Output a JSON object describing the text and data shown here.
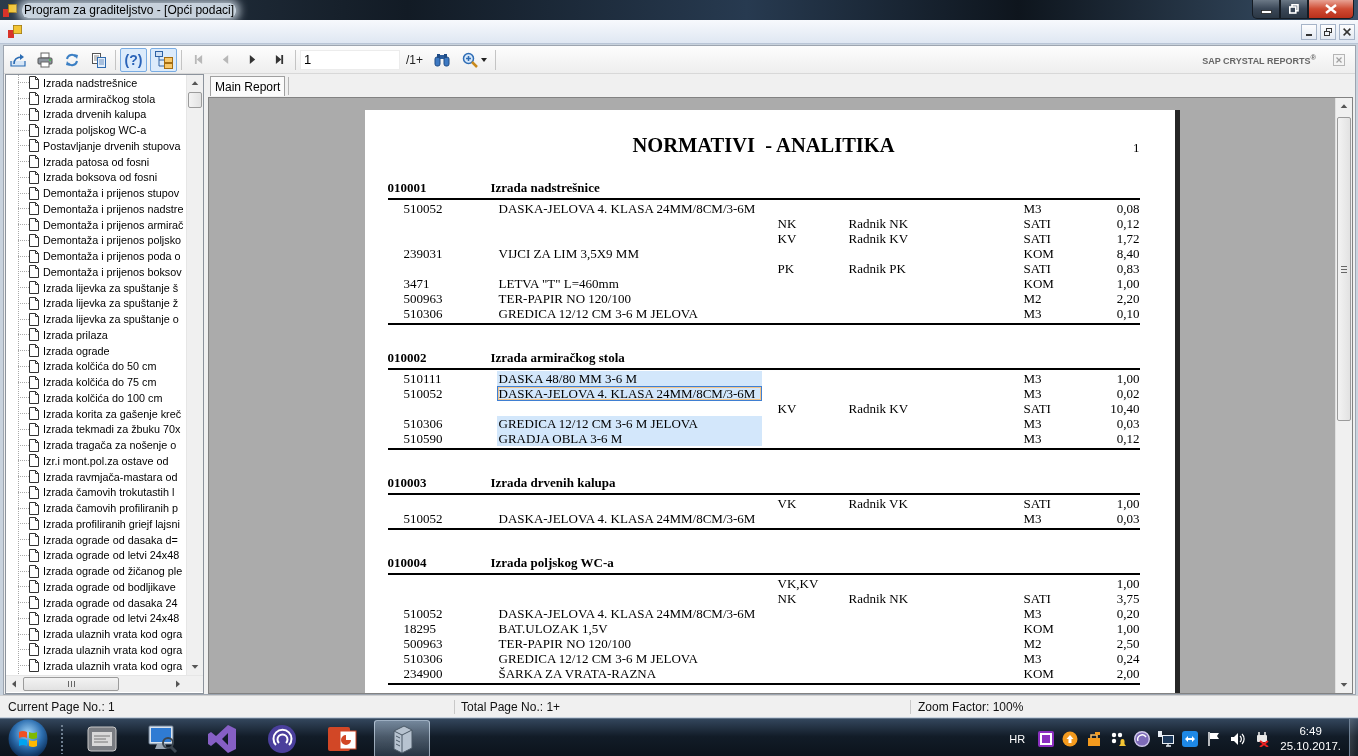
{
  "window": {
    "title": "Program za graditeljstvo - [Opći podaci]"
  },
  "toolbar": {
    "help": {
      "label": "(?)",
      "on": true
    },
    "group_tree": {
      "on": true
    },
    "nav": [
      {
        "kind": "first",
        "disabled": true
      },
      {
        "kind": "previous",
        "disabled": true
      },
      {
        "kind": "next",
        "disabled": false
      },
      {
        "kind": "last",
        "disabled": false
      }
    ],
    "page_field": {
      "value": "1"
    },
    "page_count": "/1+",
    "brand": "SAP CRYSTAL REPORTS$^{®}$"
  },
  "group_tree": {
    "items": [
      {
        "label": "Izrada nadstrešnice",
        "selected": false
      },
      {
        "label": "Izrada armiračkog stola",
        "selected": false
      },
      {
        "label": "Izrada drvenih kalupa",
        "selected": false
      },
      {
        "label": "Izrada poljskog WC-a",
        "selected": false
      },
      {
        "label": "Postavljanje drvenih stupova",
        "selected": false
      },
      {
        "label": "Izrada patosa od fosni",
        "selected": false
      },
      {
        "label": "Izrada boksova od fosni",
        "selected": false
      },
      {
        "label": "Demontaža i prijenos stupov",
        "selected": false
      },
      {
        "label": "Demontaža i prijenos nadstre",
        "selected": false
      },
      {
        "label": "Demontaža i prijenos armirač",
        "selected": false
      },
      {
        "label": "Demontaža i prijenos poljsko",
        "selected": false
      },
      {
        "label": "Demontaža i prijenos poda o",
        "selected": false
      },
      {
        "label": "Demontaža i prijenos boksov",
        "selected": false
      },
      {
        "label": "Izrada lijevka za spuštanje š",
        "selected": false
      },
      {
        "label": "Izrada lijevka za spuštanje ž",
        "selected": false
      },
      {
        "label": "Izrada lijevka za spuštanje o",
        "selected": false
      },
      {
        "label": "Izrada prilaza",
        "selected": false
      },
      {
        "label": "Izrada ograde",
        "selected": false
      },
      {
        "label": "Izrada kolčića do 50 cm",
        "selected": false
      },
      {
        "label": "Izrada kolčića do 75 cm",
        "selected": false
      },
      {
        "label": "Izrada kolčića do 100 cm",
        "selected": false
      },
      {
        "label": "Izrada korita za gašenje kreč",
        "selected": false
      },
      {
        "label": "Izrada tekmadi za žbuku 70x",
        "selected": false
      },
      {
        "label": "Izrada tragača za nošenje o",
        "selected": false
      },
      {
        "label": "Izr.i mont.pol.za ostave od",
        "selected": false
      },
      {
        "label": "Izrada ravmjača-mastara od",
        "selected": false
      },
      {
        "label": "Izrada čamovih trokutastih l",
        "selected": false
      },
      {
        "label": "Izrada čamovih profiliranih p",
        "selected": false
      },
      {
        "label": "Izrada profiliranih griejf lajsni",
        "selected": false
      },
      {
        "label": "Izrada ograde od dasaka d=",
        "selected": false
      },
      {
        "label": "Izrada ograde od letvi 24x48",
        "selected": false
      },
      {
        "label": "Izrada ograde od žičanog ple",
        "selected": false
      },
      {
        "label": "Izrada ograde od bodljikave",
        "selected": false
      },
      {
        "label": "Izrada ograde od dasaka 24",
        "selected": false
      },
      {
        "label": "Izrada ograde od letvi 24x48",
        "selected": false
      },
      {
        "label": "Izrada ulaznih vrata kod ogra",
        "selected": false
      },
      {
        "label": "Izrada ulaznih vrata kod ogra",
        "selected": false
      },
      {
        "label": "Izrada ulaznih vrata kod ogra",
        "selected": false
      }
    ]
  },
  "tabs": [
    {
      "label": "Main Report",
      "selected": true
    }
  ],
  "report": {
    "title": "NORMATIVI  - ANALITIKA",
    "page_number": "1",
    "sections": [
      {
        "heading_1": "010001",
        "heading_2": "Izrada nadstrešnice",
        "rows": [
          {
            "column_1": "510052",
            "column_2": "DASKA-JELOVA 4. KLASA 24MM/8CM/3-6M",
            "column_5": "M3",
            "column_6": "0,08",
            "selected": false,
            "focused": false
          },
          {
            "column_3": "NK",
            "column_4": "Radnik NK",
            "column_5": "SATI",
            "column_6": "0,12",
            "selected": false,
            "focused": false
          },
          {
            "column_3": "KV",
            "column_4": "Radnik KV",
            "column_5": "SATI",
            "column_6": "1,72",
            "selected": false,
            "focused": false
          },
          {
            "column_1": "239031",
            "column_2": "VIJCI ZA LIM 3,5X9 MM",
            "column_5": "KOM",
            "column_6": "8,40",
            "selected": false,
            "focused": false
          },
          {
            "column_3": "PK",
            "column_4": "Radnik PK",
            "column_5": "SATI",
            "column_6": "0,83",
            "selected": false,
            "focused": false
          },
          {
            "column_1": "3471",
            "column_2": "LETVA \"T\" L=460mm",
            "column_5": "KOM",
            "column_6": "1,00",
            "selected": false,
            "focused": false
          },
          {
            "column_1": "500963",
            "column_2": "TER-PAPIR NO 120/100",
            "column_5": "M2",
            "column_6": "2,20",
            "selected": false,
            "focused": false
          },
          {
            "column_1": "510306",
            "column_2": "GREDICA 12/12 CM 3-6 M JELOVA",
            "column_5": "M3",
            "column_6": "0,10",
            "selected": false,
            "focused": false
          }
        ]
      },
      {
        "heading_1": "010002",
        "heading_2": "Izrada armiračkog stola",
        "rows": [
          {
            "column_1": "510111",
            "column_2": "DASKA 48/80 MM 3-6 M",
            "column_5": "M3",
            "column_6": "1,00",
            "selected": true,
            "focused": false
          },
          {
            "column_1": "510052",
            "column_2": "DASKA-JELOVA 4. KLASA 24MM/8CM/3-6M",
            "column_5": "M3",
            "column_6": "0,02",
            "selected": true,
            "focused": true
          },
          {
            "column_3": "KV",
            "column_4": "Radnik KV",
            "column_5": "SATI",
            "column_6": "10,40",
            "selected": false,
            "focused": false
          },
          {
            "column_1": "510306",
            "column_2": "GREDICA 12/12 CM 3-6 M JELOVA",
            "column_5": "M3",
            "column_6": "0,03",
            "selected": true,
            "focused": false
          },
          {
            "column_1": "510590",
            "column_2": "GRADJA OBLA 3-6 M",
            "column_5": "M3",
            "column_6": "0,12",
            "selected": true,
            "focused": false
          }
        ]
      },
      {
        "heading_1": "010003",
        "heading_2": "Izrada drvenih kalupa",
        "rows": [
          {
            "column_3": "VK",
            "column_4": "Radnik VK",
            "column_5": "SATI",
            "column_6": "1,00",
            "selected": false,
            "focused": false
          },
          {
            "column_1": "510052",
            "column_2": "DASKA-JELOVA 4. KLASA 24MM/8CM/3-6M",
            "column_5": "M3",
            "column_6": "0,03",
            "selected": false,
            "focused": false
          }
        ]
      },
      {
        "heading_1": "010004",
        "heading_2": "Izrada poljskog WC-a",
        "rows": [
          {
            "column_3": "VK,KV",
            "column_6": "1,00",
            "selected": false,
            "focused": false
          },
          {
            "column_3": "NK",
            "column_4": "Radnik NK",
            "column_5": "SATI",
            "column_6": "3,75",
            "selected": false,
            "focused": false
          },
          {
            "column_1": "510052",
            "column_2": "DASKA-JELOVA 4. KLASA 24MM/8CM/3-6M",
            "column_5": "M3",
            "column_6": "0,20",
            "selected": false,
            "focused": false
          },
          {
            "column_1": "18295",
            "column_2": "BAT.ULOZAK 1,5V",
            "column_5": "KOM",
            "column_6": "1,00",
            "selected": false,
            "focused": false
          },
          {
            "column_1": "500963",
            "column_2": "TER-PAPIR NO 120/100",
            "column_5": "M2",
            "column_6": "2,50",
            "selected": false,
            "focused": false
          },
          {
            "column_1": "510306",
            "column_2": "GREDICA 12/12 CM 3-6 M JELOVA",
            "column_5": "M3",
            "column_6": "0,24",
            "selected": false,
            "focused": false
          },
          {
            "column_1": "234900",
            "column_2": "ŠARKA ZA VRATA-RAZNA",
            "column_5": "KOM",
            "column_6": "2,00",
            "selected": false,
            "focused": false
          }
        ]
      }
    ]
  },
  "status_bar": {
    "current_page": "Current Page No.: 1",
    "total_pages": "Total Page No.: 1+",
    "zoom": "Zoom Factor: 100%"
  },
  "taskbar": {
    "apps": [
      {
        "kind": "panel",
        "active": false
      },
      {
        "kind": "monitor",
        "active": false
      },
      {
        "kind": "ribbon",
        "active": false
      },
      {
        "kind": "disc",
        "active": false
      },
      {
        "kind": "slides",
        "active": false
      },
      {
        "kind": "tower",
        "active": true
      }
    ],
    "language": "HR",
    "time": "6:49",
    "date": "25.10.2017."
  }
}
